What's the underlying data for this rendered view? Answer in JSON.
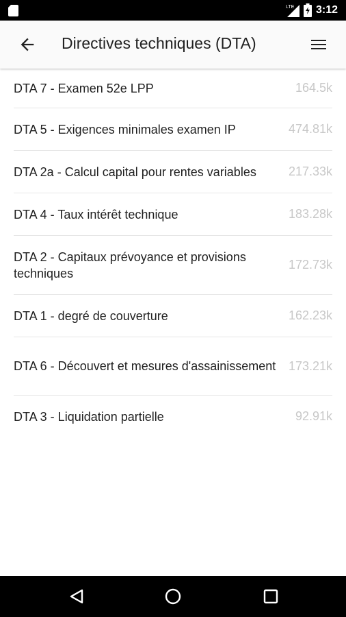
{
  "status_bar": {
    "time": "3:12",
    "network": "LTE",
    "icons": [
      "sim-card-icon",
      "lte-signal-icon",
      "battery-icon"
    ]
  },
  "app_bar": {
    "title": "Directives techniques (DTA)",
    "back_icon": "arrow-left-icon",
    "menu_icon": "hamburger-menu-icon"
  },
  "documents": [
    {
      "label": "DTA 7 - Examen 52e LPP",
      "size": "164.5k"
    },
    {
      "label": "DTA 5 - Exigences minimales examen IP",
      "size": "474.81k"
    },
    {
      "label": "DTA 2a - Calcul capital pour rentes variables",
      "size": "217.33k"
    },
    {
      "label": "DTA 4 - Taux intérêt technique",
      "size": "183.28k"
    },
    {
      "label": "DTA 2 - Capitaux prévoyance et provisions techniques",
      "size": "172.73k"
    },
    {
      "label": "DTA 1 - degré de couverture",
      "size": "162.23k"
    },
    {
      "label": "DTA 6 - Découvert et mesures d'assainissement",
      "size": "173.21k"
    },
    {
      "label": "DTA 3 - Liquidation partielle",
      "size": "92.91k"
    }
  ],
  "nav_bar": {
    "icons": [
      "back-triangle-icon",
      "home-circle-icon",
      "recents-square-icon"
    ]
  }
}
